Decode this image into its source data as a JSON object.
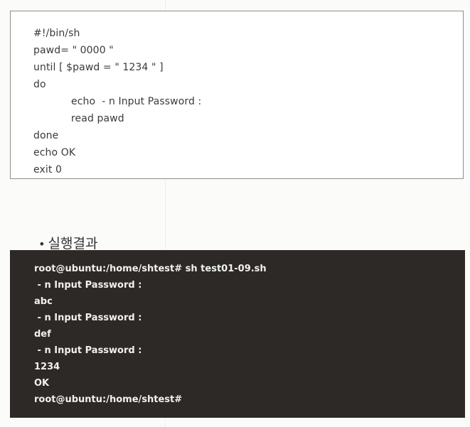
{
  "script": {
    "lines": [
      "#!/bin/sh",
      "pawd= \" 0000 \"",
      "until [ $pawd = \" 1234 \" ]",
      "do",
      "echo  - n Input Password :",
      "read pawd",
      "done",
      "echo OK",
      "exit 0"
    ]
  },
  "result": {
    "bullet": "•",
    "heading": "실행결과"
  },
  "terminal": {
    "lines": [
      "root@ubuntu:/home/shtest# sh test01-09.sh",
      " - n Input Password :",
      "abc",
      " - n Input Password :",
      "def",
      " - n Input Password :",
      "1234",
      "OK",
      "root@ubuntu:/home/shtest#"
    ]
  }
}
